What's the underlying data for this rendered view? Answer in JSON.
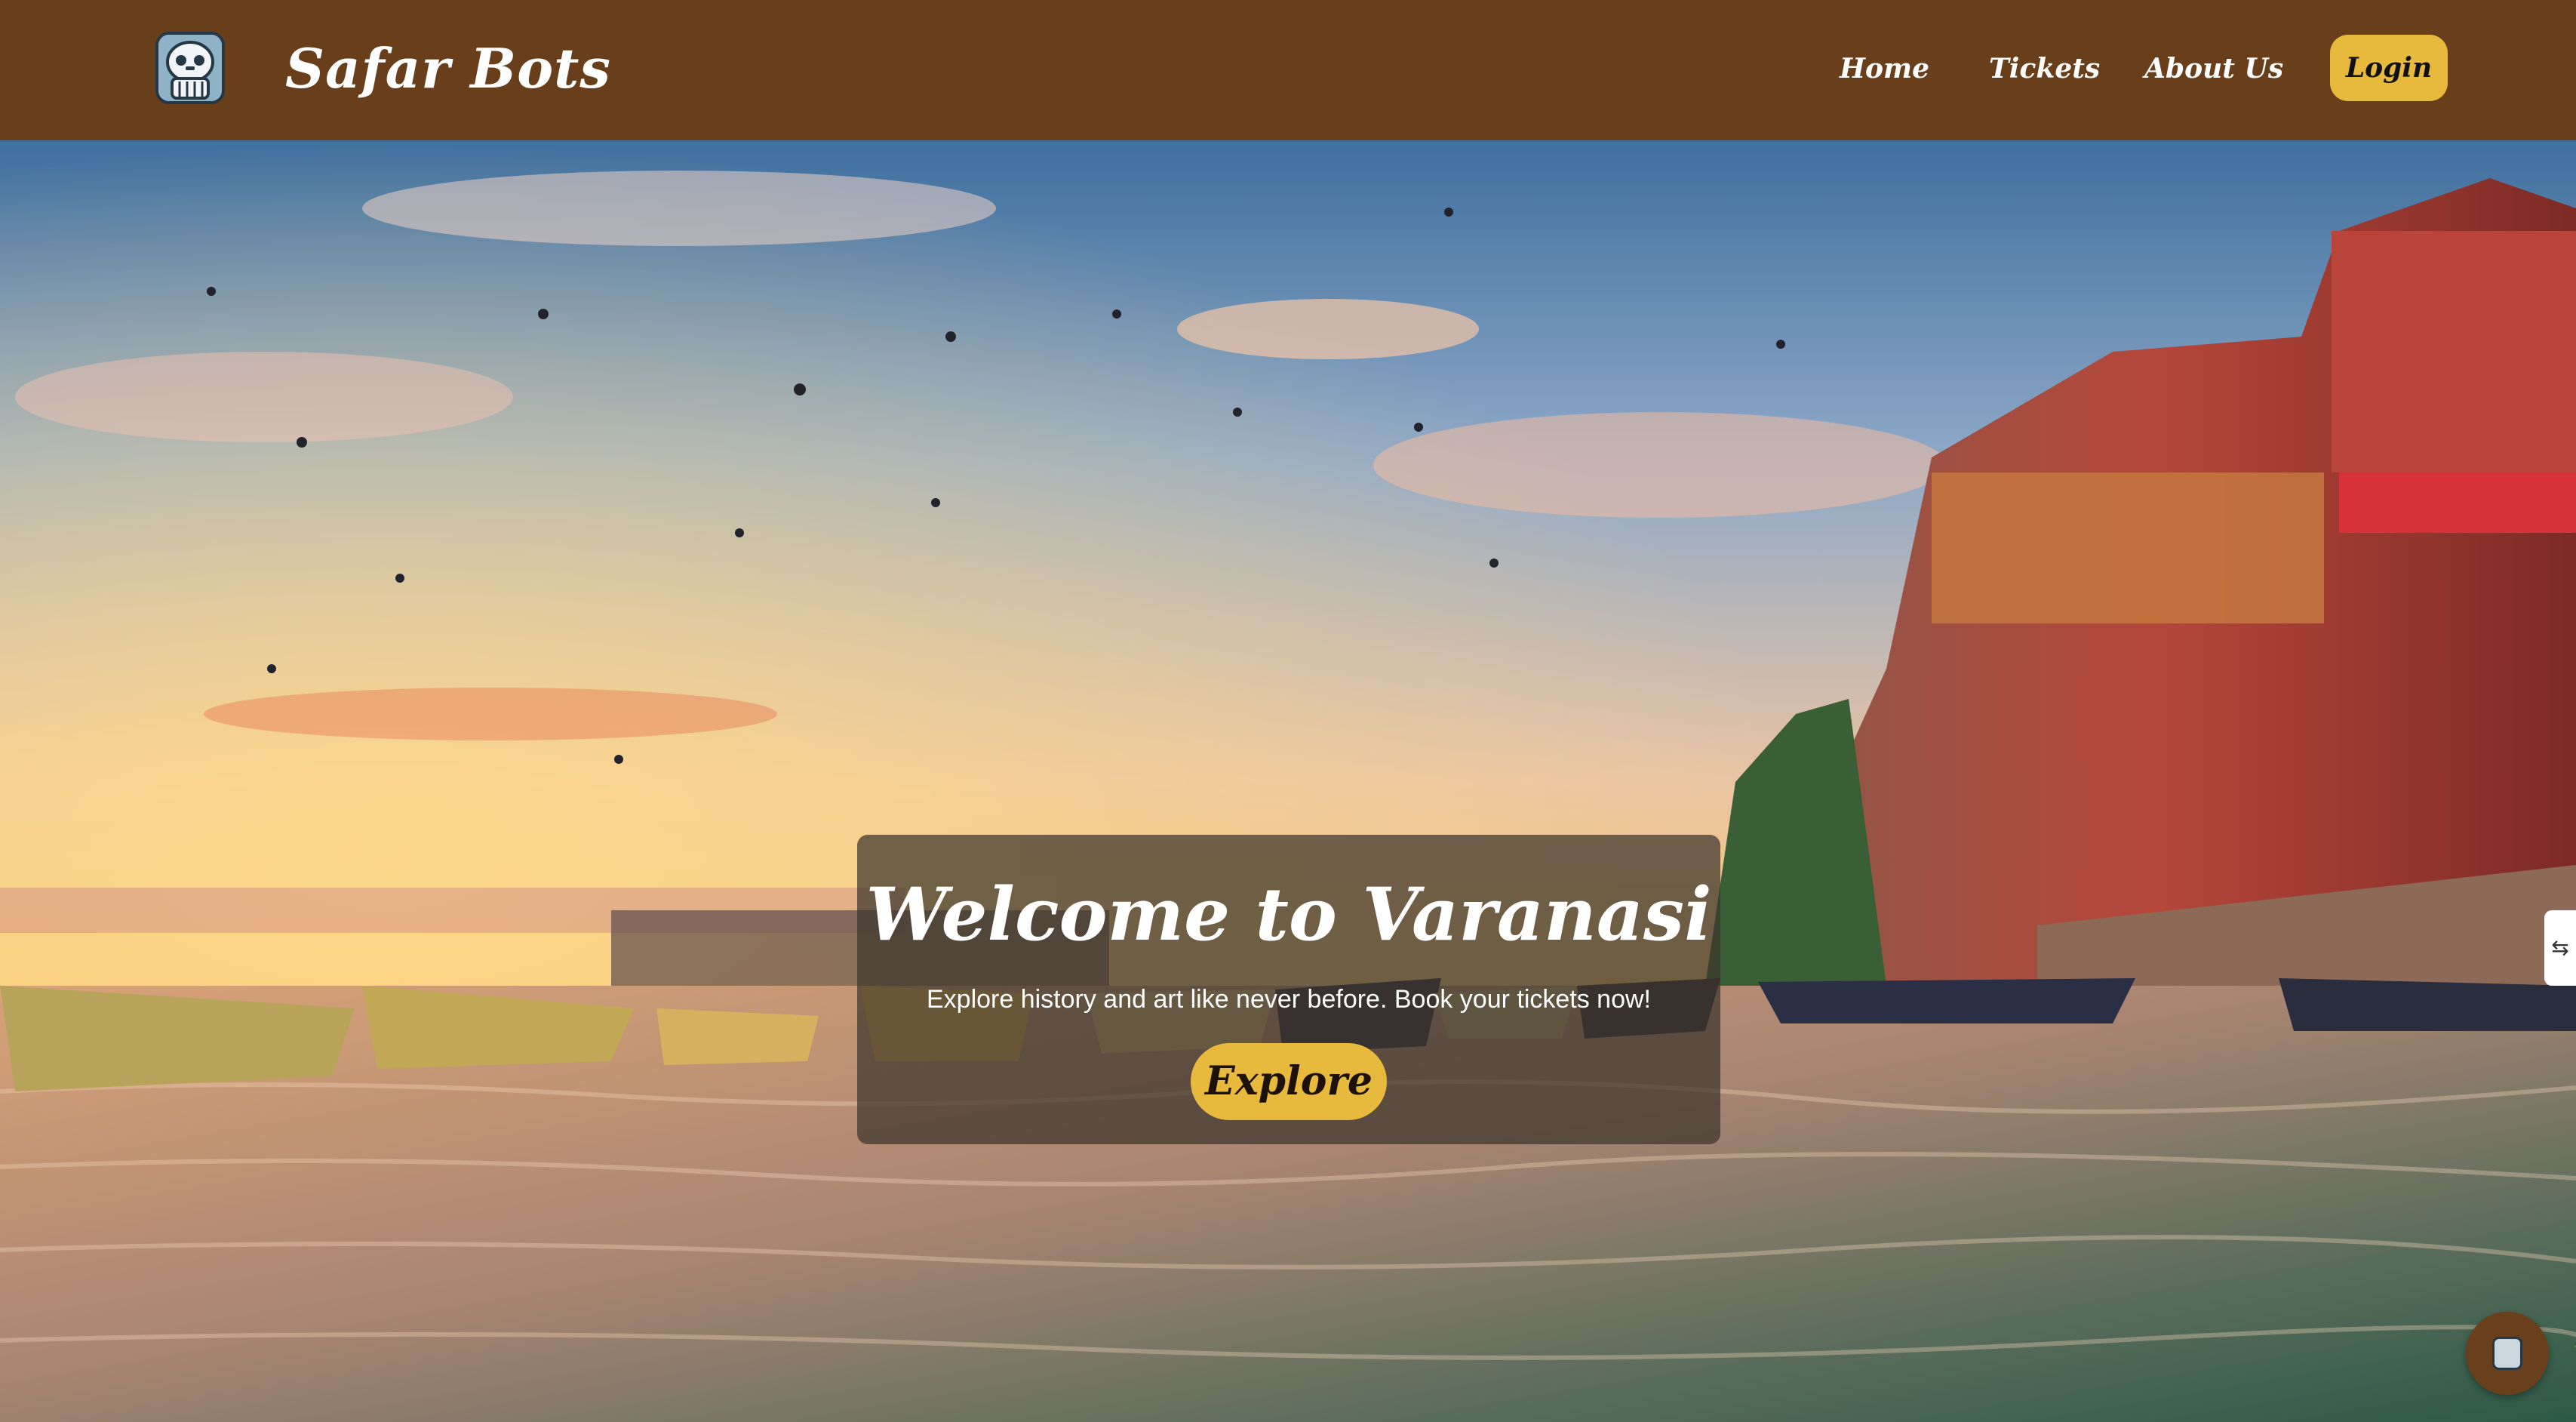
{
  "header": {
    "brand": "Safar Bots",
    "nav": [
      {
        "label": "Home"
      },
      {
        "label": "Tickets"
      },
      {
        "label": "About Us"
      }
    ],
    "login_label": "Login"
  },
  "hero": {
    "title": "Welcome to Varanasi",
    "subtitle": "Explore history and art like never before. Book your tickets now!",
    "cta_label": "Explore"
  },
  "side_tab": {
    "label": "⇆"
  },
  "colors": {
    "header_bg": "#693f1b",
    "accent": "#e7b93c",
    "overlay": "rgba(60,52,45,0.72)"
  },
  "icons": {
    "logo": "robot-logo-icon",
    "chat": "chatbot-icon"
  }
}
